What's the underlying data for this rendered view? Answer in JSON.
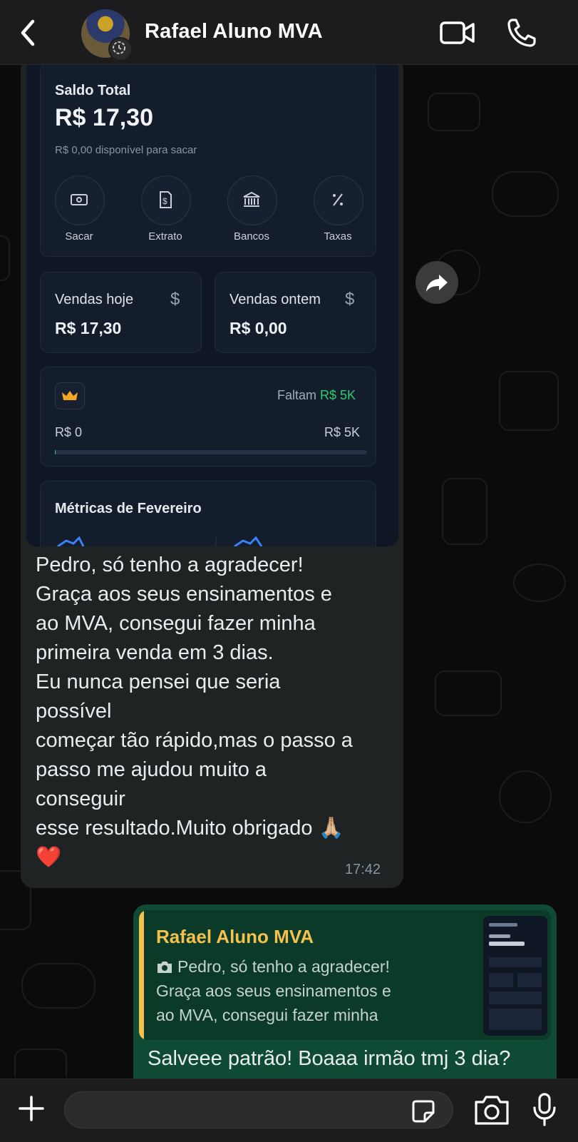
{
  "header": {
    "contact_name": "Rafael Aluno MVA",
    "icons": [
      "back-icon",
      "avatar",
      "video-call-icon",
      "phone-icon"
    ]
  },
  "screenshot": {
    "balance_title": "Saldo Total",
    "balance_value": "R$ 17,30",
    "balance_sub": "R$ 0,00 disponível para sacar",
    "actions": [
      {
        "label": "Sacar",
        "icon": "cash-icon"
      },
      {
        "label": "Extrato",
        "icon": "receipt-icon"
      },
      {
        "label": "Bancos",
        "icon": "bank-icon"
      },
      {
        "label": "Taxas",
        "icon": "percent-icon"
      }
    ],
    "sales_today_label": "Vendas hoje",
    "sales_today_value": "R$ 17,30",
    "sales_yesterday_label": "Vendas ontem",
    "sales_yesterday_value": "R$ 0,00",
    "dollar_sign": "$",
    "goal_prefix": "Faltam",
    "goal_amount": "R$ 5K",
    "goal_start": "R$ 0",
    "goal_end": "R$ 5K",
    "goal_progress": 0.003,
    "metrics_title": "Métricas de Fevereiro"
  },
  "incoming": {
    "lines": [
      "Pedro, só tenho a agradecer!",
      "Graça aos seus ensinamentos e",
      "ao MVA, consegui fazer minha",
      "primeira venda em 3 dias.",
      "Eu nunca pensei que seria",
      "possível",
      "começar tão rápido,mas o passo a",
      "passo me ajudou muito a",
      "conseguir",
      "esse resultado.Muito obrigado 🙏🏼",
      "❤️"
    ],
    "time": "17:42"
  },
  "outgoing": {
    "quote_author": "Rafael Aluno MVA",
    "quote_lines": [
      "Pedro, só tenho a agradecer!",
      "Graça aos seus ensinamentos e",
      "ao MVA, consegui fazer minha"
    ],
    "text": "Salveee patrão! Boaaa irmão tmj 3 dia?"
  },
  "input": {
    "placeholder": "",
    "value": ""
  },
  "colors": {
    "incoming_bubble": "#202324",
    "outgoing_bubble": "#0f4a35",
    "quote_accent": "#f2c14e",
    "goal_green": "#2ecc71"
  }
}
